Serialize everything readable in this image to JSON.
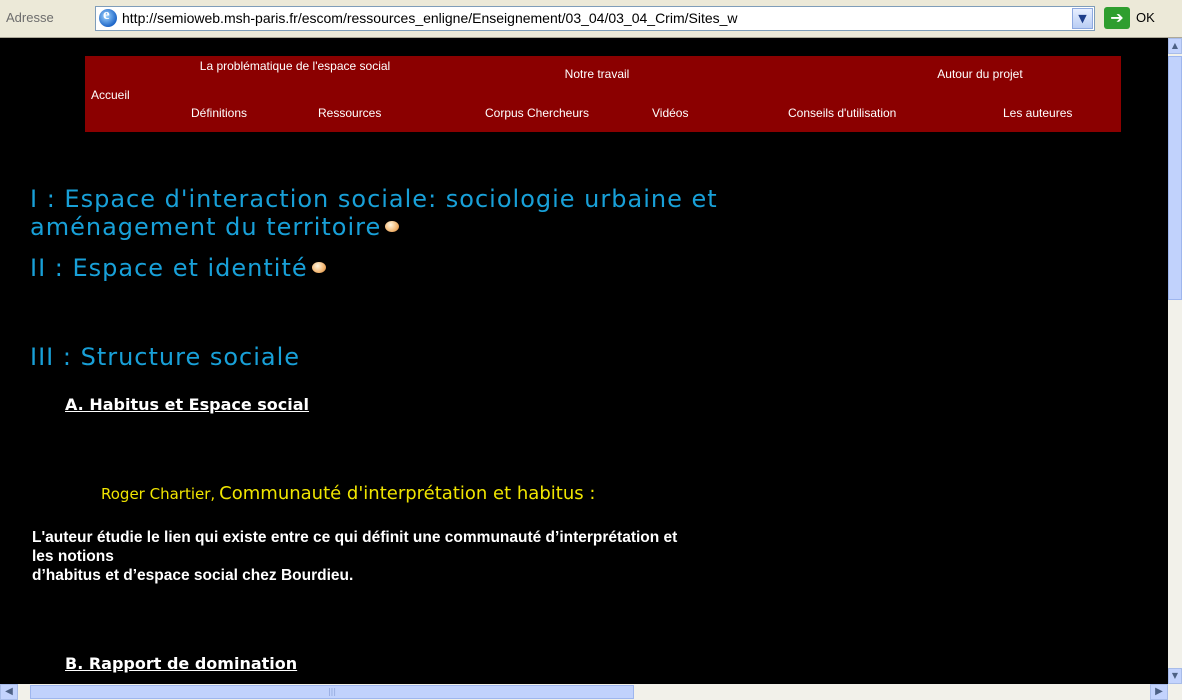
{
  "address_bar": {
    "label": "Adresse",
    "url": "http://semioweb.msh-paris.fr/escom/ressources_enligne/Enseignement/03_04/03_04_Crim/Sites_w",
    "go_label": "OK"
  },
  "nav": {
    "home": "Accueil",
    "group1": "La problématique de l'espace social",
    "group2": "Notre travail",
    "group3": "Autour du projet",
    "items": [
      "Définitions",
      "Ressources",
      "Corpus",
      "Chercheurs",
      "Vidéos",
      "Conseils d'utilisation",
      "Les auteures"
    ]
  },
  "sections": {
    "s1_line1": "I : Espace d'interaction sociale: sociologie urbaine et",
    "s1_line2": "aménagement du territoire",
    "s2": "II : Espace et identité",
    "s3": "III : Structure sociale",
    "sub_a": "A. Habitus et Espace social",
    "sub_b": "B. Rapport de domination"
  },
  "quote": {
    "author": "Roger Chartier,",
    "title": "Communauté d'interprétation et habitus :"
  },
  "paragraph": {
    "line1": "L'auteur étudie le lien qui existe entre ce qui définit une communauté d’interprétation et",
    "line2": "les notions",
    "line3": "d’habitus et d’espace social chez Bourdieu."
  }
}
